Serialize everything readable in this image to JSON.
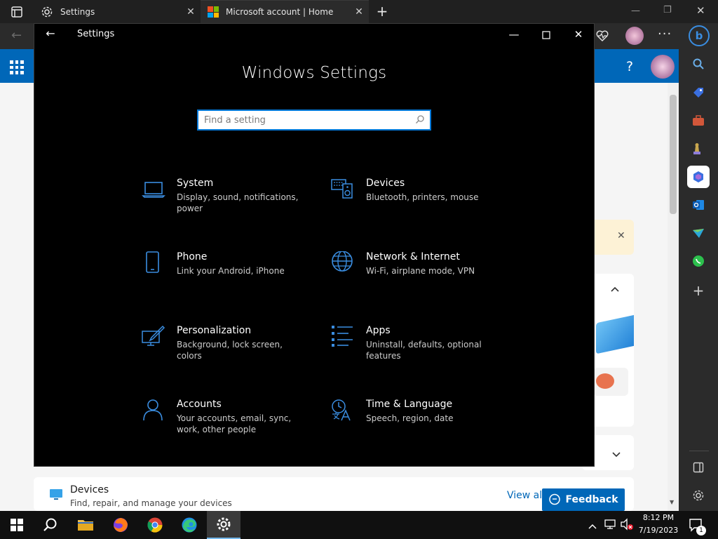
{
  "browser": {
    "tabs": [
      {
        "label": "Settings",
        "icon": "gear-icon"
      },
      {
        "label": "Microsoft account | Home",
        "icon": "microsoft-logo-icon"
      }
    ],
    "sidebar_icons": [
      "search-icon",
      "tag-icon",
      "briefcase-icon",
      "chess-icon",
      "copilot-icon",
      "outlook-icon",
      "drop-icon",
      "whatsapp-icon",
      "add-icon",
      "split-icon",
      "gear-icon"
    ]
  },
  "webpage": {
    "devices_title": "Devices",
    "devices_desc": "Find, repair, and manage your devices",
    "view_all": "View all",
    "feedback": "Feedback",
    "help": "?"
  },
  "settings": {
    "window_title": "Settings",
    "heading": "Windows Settings",
    "search": {
      "value": "",
      "placeholder": "Find a setting"
    },
    "categories": [
      {
        "title": "System",
        "desc": "Display, sound, notifications, power",
        "icon": "laptop-icon"
      },
      {
        "title": "Devices",
        "desc": "Bluetooth, printers, mouse",
        "icon": "keyboard-speaker-icon"
      },
      {
        "title": "Phone",
        "desc": "Link your Android, iPhone",
        "icon": "phone-icon"
      },
      {
        "title": "Network & Internet",
        "desc": "Wi-Fi, airplane mode, VPN",
        "icon": "globe-icon"
      },
      {
        "title": "Personalization",
        "desc": "Background, lock screen, colors",
        "icon": "paint-brush-icon"
      },
      {
        "title": "Apps",
        "desc": "Uninstall, defaults, optional features",
        "icon": "apps-list-icon"
      },
      {
        "title": "Accounts",
        "desc": "Your accounts, email, sync, work, other people",
        "icon": "person-icon"
      },
      {
        "title": "Time & Language",
        "desc": "Speech, region, date",
        "icon": "time-language-icon"
      }
    ]
  },
  "taskbar": {
    "time": "8:12 PM",
    "date": "7/19/2023",
    "notification_count": "1"
  },
  "colors": {
    "accent": "#0078d7",
    "icon_blue": "#3a8de0",
    "settings_bg": "#000000"
  }
}
